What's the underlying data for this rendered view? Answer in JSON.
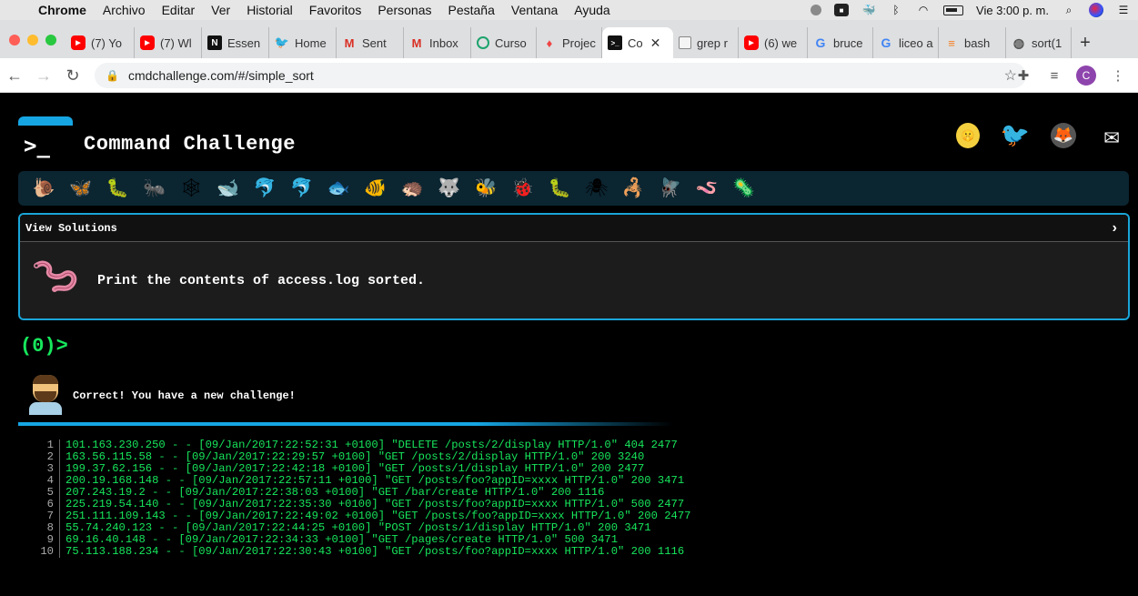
{
  "menubar": {
    "items": [
      "Chrome",
      "Archivo",
      "Editar",
      "Ver",
      "Historial",
      "Favoritos",
      "Personas",
      "Pestaña",
      "Ventana",
      "Ayuda"
    ],
    "clock": "Vie 3:00 p. m."
  },
  "tabs": [
    {
      "label": "(7) Yo",
      "icon": "youtube-icon"
    },
    {
      "label": "(7) Wl",
      "icon": "youtube-icon"
    },
    {
      "label": "Essen",
      "icon": "notion-icon"
    },
    {
      "label": "Home",
      "icon": "twitter-icon"
    },
    {
      "label": "Sent",
      "icon": "gmail-icon"
    },
    {
      "label": "Inbox",
      "icon": "gmail-icon"
    },
    {
      "label": "Curso",
      "icon": "course-icon"
    },
    {
      "label": "Projec",
      "icon": "project-icon"
    },
    {
      "label": "Co",
      "icon": "terminal-icon",
      "active": true
    },
    {
      "label": "grep r",
      "icon": "document-icon"
    },
    {
      "label": "(6) we",
      "icon": "youtube-icon"
    },
    {
      "label": "bruce",
      "icon": "google-icon"
    },
    {
      "label": "liceo a",
      "icon": "google-icon"
    },
    {
      "label": "bash",
      "icon": "stackoverflow-icon"
    },
    {
      "label": "sort(1",
      "icon": "globe-icon"
    }
  ],
  "toolbar": {
    "url": "cmdchallenge.com/#/simple_sort",
    "avatar_letter": "C"
  },
  "site": {
    "title": "Command Challenge",
    "logo_glyph": ">_"
  },
  "panel": {
    "header": "View Solutions",
    "task": "Print the contents of access.log sorted."
  },
  "prompt": "(0)>",
  "result_message": "Correct! You have a new challenge!",
  "output_lines": [
    "101.163.230.250 - - [09/Jan/2017:22:52:31 +0100] \"DELETE /posts/2/display HTTP/1.0\" 404 2477",
    "163.56.115.58 - - [09/Jan/2017:22:29:57 +0100] \"GET /posts/2/display HTTP/1.0\" 200 3240",
    "199.37.62.156 - - [09/Jan/2017:22:42:18 +0100] \"GET /posts/1/display HTTP/1.0\" 200 2477",
    "200.19.168.148 - - [09/Jan/2017:22:57:11 +0100] \"GET /posts/foo?appID=xxxx HTTP/1.0\" 200 3471",
    "207.243.19.2 - - [09/Jan/2017:22:38:03 +0100] \"GET /bar/create HTTP/1.0\" 200 1116",
    "225.219.54.140 - - [09/Jan/2017:22:35:30 +0100] \"GET /posts/foo?appID=xxxx HTTP/1.0\" 500 2477",
    "251.111.109.143 - - [09/Jan/2017:22:49:02 +0100] \"GET /posts/foo?appID=xxxx HTTP/1.0\" 200 2477",
    "55.74.240.123 - - [09/Jan/2017:22:44:25 +0100] \"POST /posts/1/display HTTP/1.0\" 200 3471",
    "69.16.40.148 - - [09/Jan/2017:22:34:33 +0100] \"GET /pages/create HTTP/1.0\" 500 3471",
    "75.113.188.234 - - [09/Jan/2017:22:30:43 +0100] \"GET /posts/foo?appID=xxxx HTTP/1.0\" 200 1116"
  ],
  "critters": [
    "🐌",
    "🦋",
    "🐛",
    "🐜",
    "🕸",
    "🐋",
    "🐬",
    "🐬",
    "🐟",
    "🐠",
    "🦔",
    "🐺",
    "🐝",
    "🐞",
    "🐛",
    "🕷",
    "🦂",
    "🪰",
    "🪱",
    "🦠"
  ],
  "colors": {
    "accent": "#16a6e4",
    "terminal_green": "#17e65c",
    "background": "#000000"
  }
}
